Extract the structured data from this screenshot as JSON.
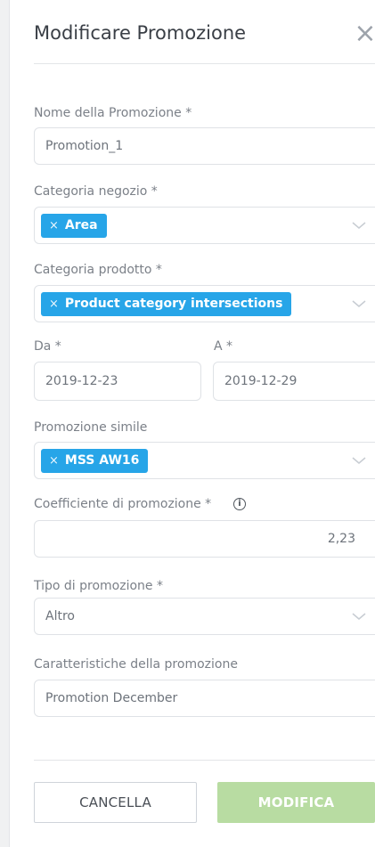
{
  "title": "Modificare Promozione",
  "fields": {
    "name_label": "Nome della Promozione *",
    "name_value": "Promotion_1",
    "store_category_label": "Categoria negozio *",
    "store_category_tag": "Area",
    "product_category_label": "Categoria prodotto *",
    "product_category_tag": "Product category intersections",
    "from_label": "Da *",
    "from_value": "2019-12-23",
    "to_label": "A *",
    "to_value": "2019-12-29",
    "similar_label": "Promozione simile",
    "similar_tag": "MSS AW16",
    "coefficient_label": "Coefficiente di promozione *",
    "coefficient_value": "2,23",
    "type_label": "Tipo di promozione *",
    "type_value": "Altro",
    "features_label": "Caratteristiche della promozione",
    "features_value": "Promotion December"
  },
  "buttons": {
    "cancel": "CANCELLA",
    "modify": "MODIFICA"
  },
  "colors": {
    "tag": "#27a5e8",
    "primary_disabled": "#b8dca2",
    "text": "#555a61"
  }
}
